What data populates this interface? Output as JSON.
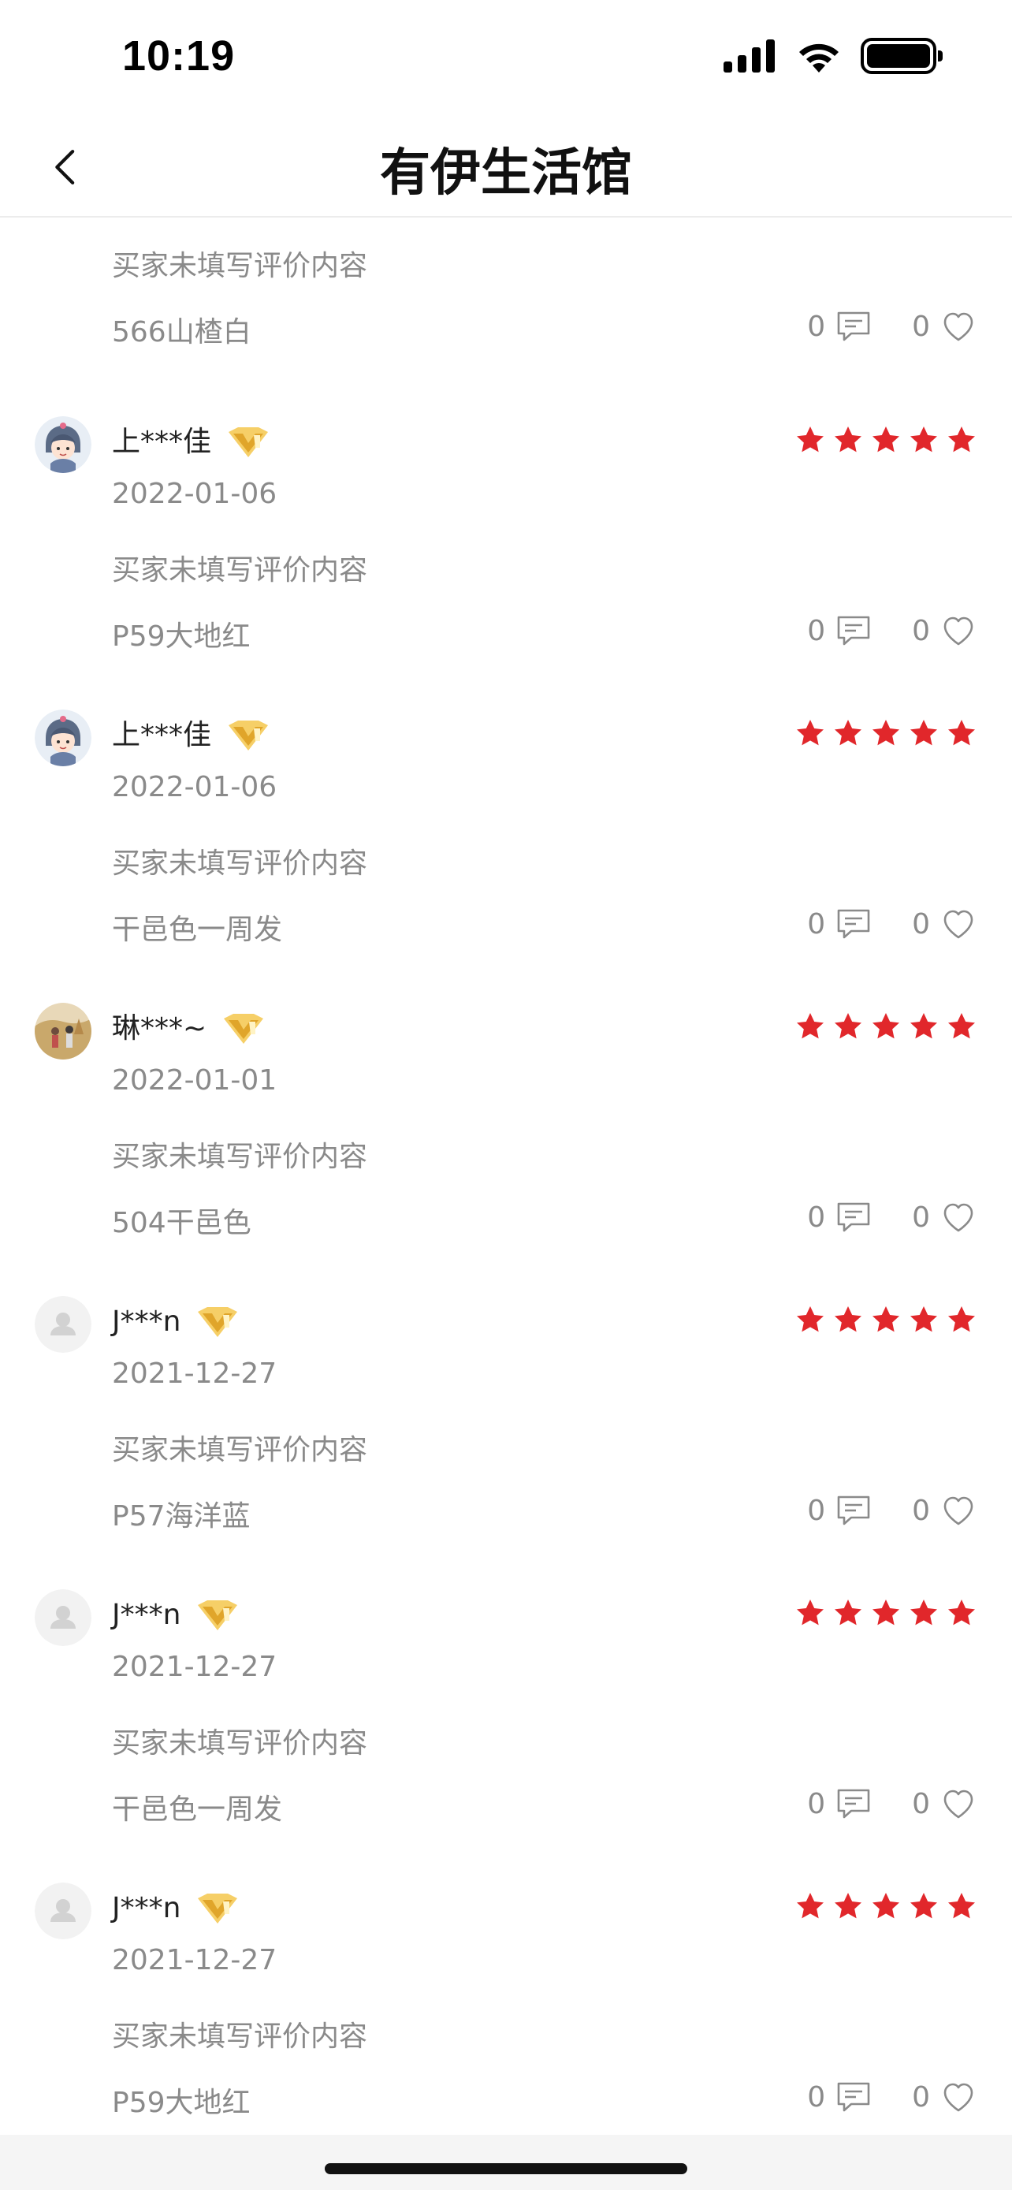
{
  "status_bar": {
    "time": "10:19",
    "battery_level": 1.0
  },
  "header": {
    "title": "有伊生活馆",
    "back_icon": "chevron-left-icon"
  },
  "colors": {
    "star": "#e1272b",
    "badge_gold": "#f2b63c",
    "muted_text": "#8a8a8a"
  },
  "reviews": [
    {
      "user": "",
      "date": "",
      "content": "买家未填写评价内容",
      "sku": "566山楂白",
      "comments": "0",
      "likes": "0"
    },
    {
      "user": "上***佳",
      "date": "2022-01-06",
      "rating": 5,
      "content": "买家未填写评价内容",
      "sku": "P59大地红",
      "comments": "0",
      "likes": "0"
    },
    {
      "user": "上***佳",
      "date": "2022-01-06",
      "rating": 5,
      "content": "买家未填写评价内容",
      "sku": "干邑色一周发",
      "comments": "0",
      "likes": "0"
    },
    {
      "user": "琳***~",
      "date": "2022-01-01",
      "rating": 5,
      "content": "买家未填写评价内容",
      "sku": "504干邑色",
      "comments": "0",
      "likes": "0"
    },
    {
      "user": "J***n",
      "date": "2021-12-27",
      "rating": 5,
      "content": "买家未填写评价内容",
      "sku": "P57海洋蓝",
      "comments": "0",
      "likes": "0"
    },
    {
      "user": "J***n",
      "date": "2021-12-27",
      "rating": 5,
      "content": "买家未填写评价内容",
      "sku": "干邑色一周发",
      "comments": "0",
      "likes": "0"
    },
    {
      "user": "J***n",
      "date": "2021-12-27",
      "rating": 5,
      "content": "买家未填写评价内容",
      "sku": "P59大地红",
      "comments": "0",
      "likes": "0"
    }
  ]
}
